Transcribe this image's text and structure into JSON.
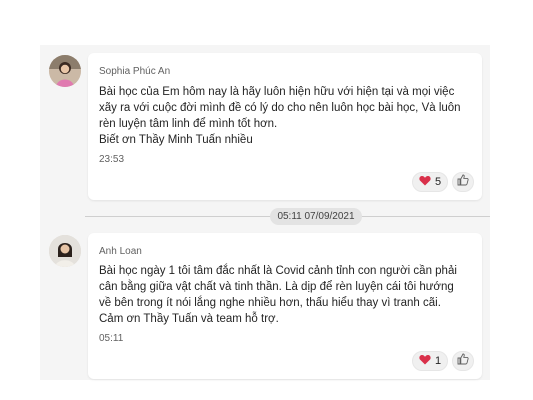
{
  "messages": [
    {
      "sender": "Sophia Phúc An",
      "lines": [
        "Bài học của Em hôm nay là hãy luôn hiện hữu với hiện tại và mọi việc",
        "xãy ra với cuộc đời mình đề có lý do cho nên luôn học bài học, Và luôn",
        "rèn luyện tâm linh để mình tốt hơn.",
        "Biết ơn Thầy Minh Tuấn nhiều"
      ],
      "time": "23:53",
      "reaction_count": "5"
    },
    {
      "sender": "Anh Loan",
      "lines": [
        "Bài học ngày 1 tôi tâm đắc nhất là Covid cảnh tỉnh con người cần phải",
        "cân bằng giữa vật chất và tinh thần. Là dịp để rèn luyện cái tôi hướng",
        "về bên trong ít nói lắng nghe nhiều hơn, thấu hiểu thay vì tranh cãi.",
        "Cảm ơn Thầy Tuấn và team hỗ trợ."
      ],
      "time": "05:11",
      "reaction_count": "1"
    }
  ],
  "date_divider": "05:11 07/09/2021",
  "icons": {
    "reaction": "heart-icon",
    "like": "thumbs-up-icon"
  },
  "colors": {
    "heart": "#d9304a",
    "panel_bg": "#f5f5f5",
    "bubble_bg": "#ffffff"
  }
}
